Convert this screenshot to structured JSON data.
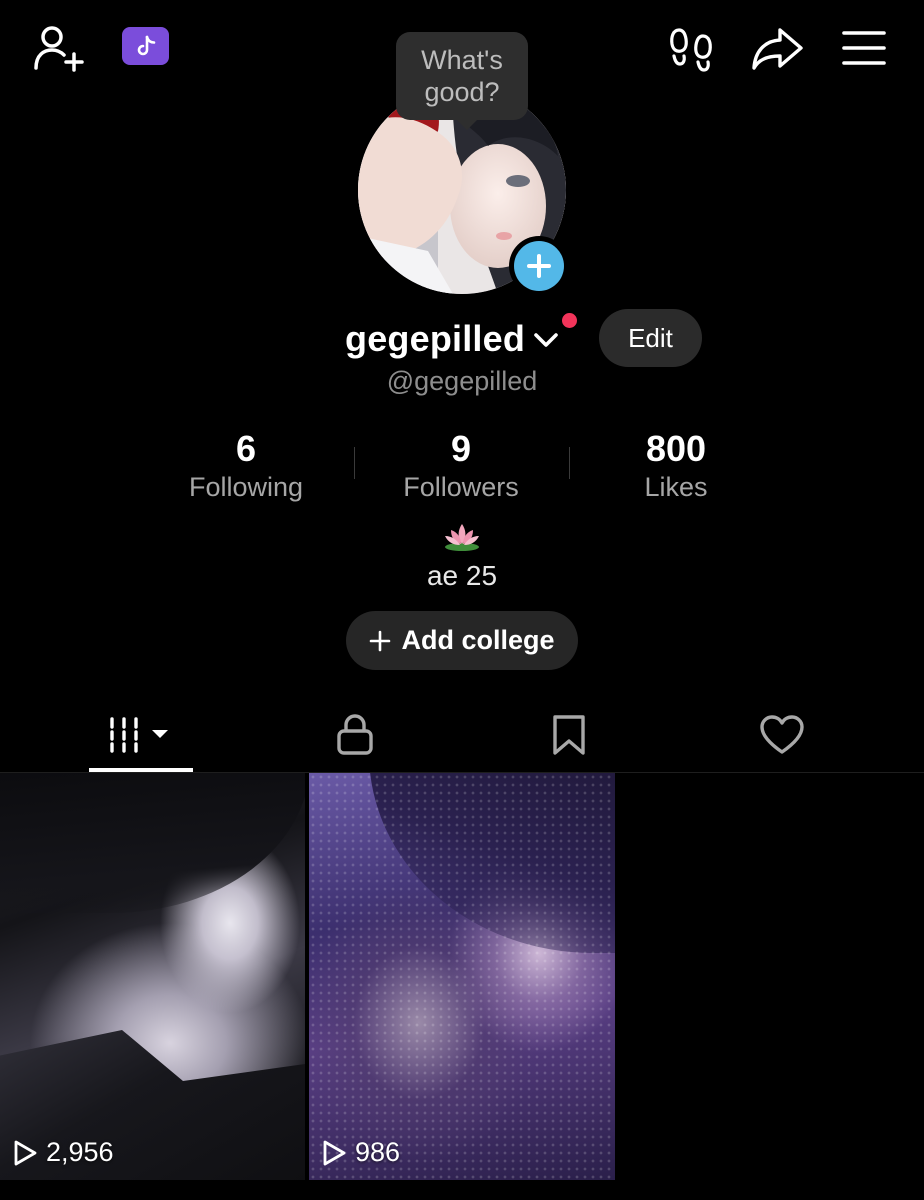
{
  "header": {
    "icons": [
      "add-friend-icon",
      "tiktok-ticket-icon",
      "footprints-icon",
      "share-icon",
      "menu-icon"
    ]
  },
  "profile": {
    "tooltip": "What's good?",
    "display_name": "gegepilled",
    "username": "@gegepilled",
    "edit_label": "Edit",
    "bio_emoji": "🪷",
    "bio": "ae 25",
    "add_college_label": "Add college"
  },
  "stats": [
    {
      "value": "6",
      "label": "Following"
    },
    {
      "value": "9",
      "label": "Followers"
    },
    {
      "value": "800",
      "label": "Likes"
    }
  ],
  "tabs": [
    {
      "icon": "videos-grid-icon",
      "active": true
    },
    {
      "icon": "lock-icon",
      "active": false
    },
    {
      "icon": "bookmark-icon",
      "active": false
    },
    {
      "icon": "heart-icon",
      "active": false
    }
  ],
  "videos": [
    {
      "views": "2,956"
    },
    {
      "views": "986"
    }
  ],
  "colors": {
    "background": "#000000",
    "ticket": "#7b4ddb",
    "avatar_add": "#53b8e8",
    "notification_dot": "#f2345a",
    "button_bg": "#2b2b2b"
  }
}
